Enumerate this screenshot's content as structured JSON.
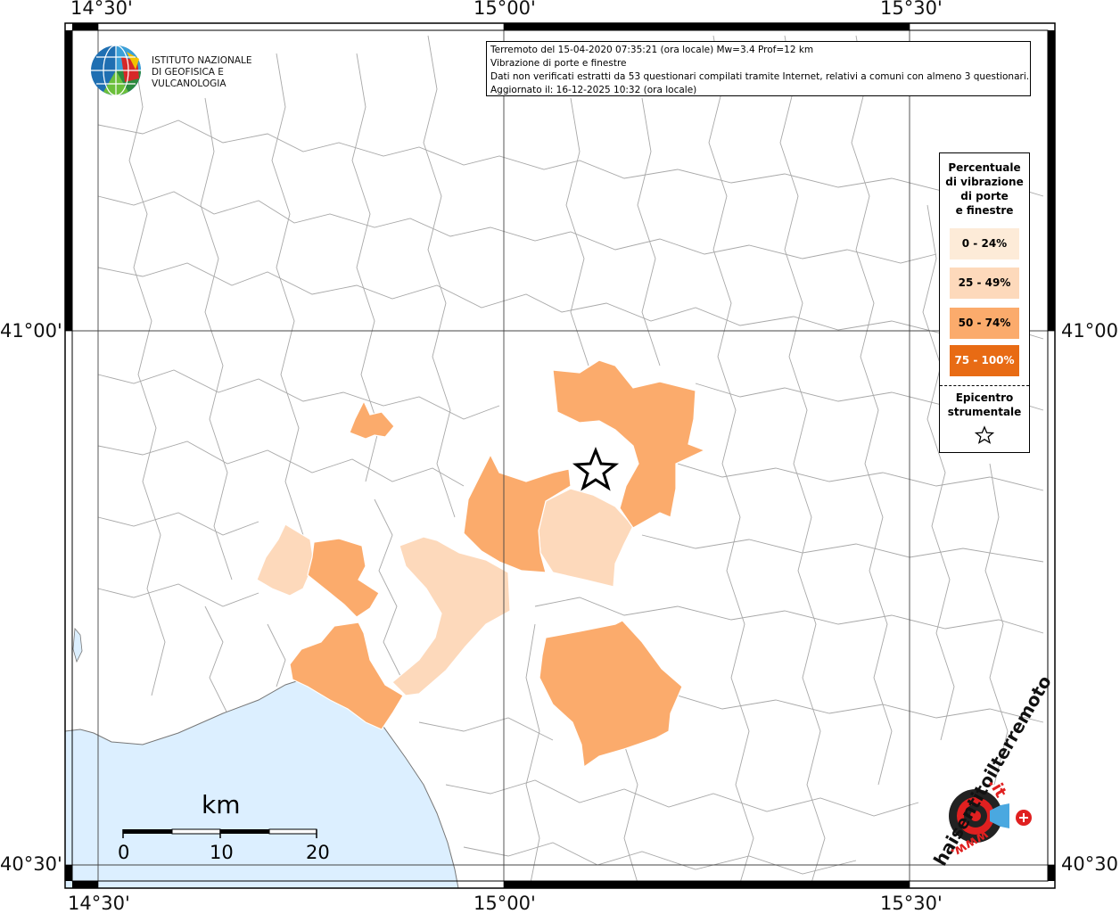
{
  "frame_labels": {
    "top": [
      "14°30'",
      "15°00'",
      "15°30'"
    ],
    "bottom": [
      "14°30'",
      "15°00'",
      "15°30'"
    ],
    "left": [
      "41°00'",
      "40°30'"
    ],
    "right": [
      "41°00'",
      "40°30'"
    ]
  },
  "info_box": {
    "line1": "Terremoto del 15-04-2020 07:35:21 (ora locale) Mw=3.4 Prof=12 km",
    "line2": "Vibrazione di porte e finestre",
    "line3": "Dati non verificati estratti da 53 questionari compilati tramite Internet, relativi a comuni con almeno 3 questionari.",
    "line4": "Aggiornato il: 16-12-2025 10:32 (ora locale)"
  },
  "legend": {
    "title": [
      "Percentuale",
      "di vibrazione",
      "di porte",
      "e finestre"
    ],
    "classes": [
      {
        "label": "0 - 24%",
        "color": "#fdebd8"
      },
      {
        "label": "25 - 49%",
        "color": "#fdd9bb"
      },
      {
        "label": "50 - 74%",
        "color": "#fbab6c"
      },
      {
        "label": "75 - 100%",
        "color": "#e86b14"
      }
    ],
    "epicenter_label": [
      "Epicentro",
      "strumentale"
    ],
    "epicenter_icon": "star-icon"
  },
  "logo_ingv": {
    "line1": "ISTITUTO NAZIONALE",
    "line2": "DI GEOFISICA E VULCANOLOGIA",
    "icon": "globe-icon"
  },
  "scale_bar": {
    "title": "km",
    "ticks": [
      "0",
      "10",
      "20"
    ]
  },
  "logo_hsit": {
    "text_main": "haisentitoilterremoto",
    "text_domain": ".it",
    "text_www": "www.",
    "icon": "speaker-target-icon"
  },
  "colors": {
    "sea": "#dcefff",
    "boundary": "#9a9a9a",
    "grid": "#444444",
    "class_25_49": "#fdd9bb",
    "class_50_74": "#fbab6c"
  }
}
